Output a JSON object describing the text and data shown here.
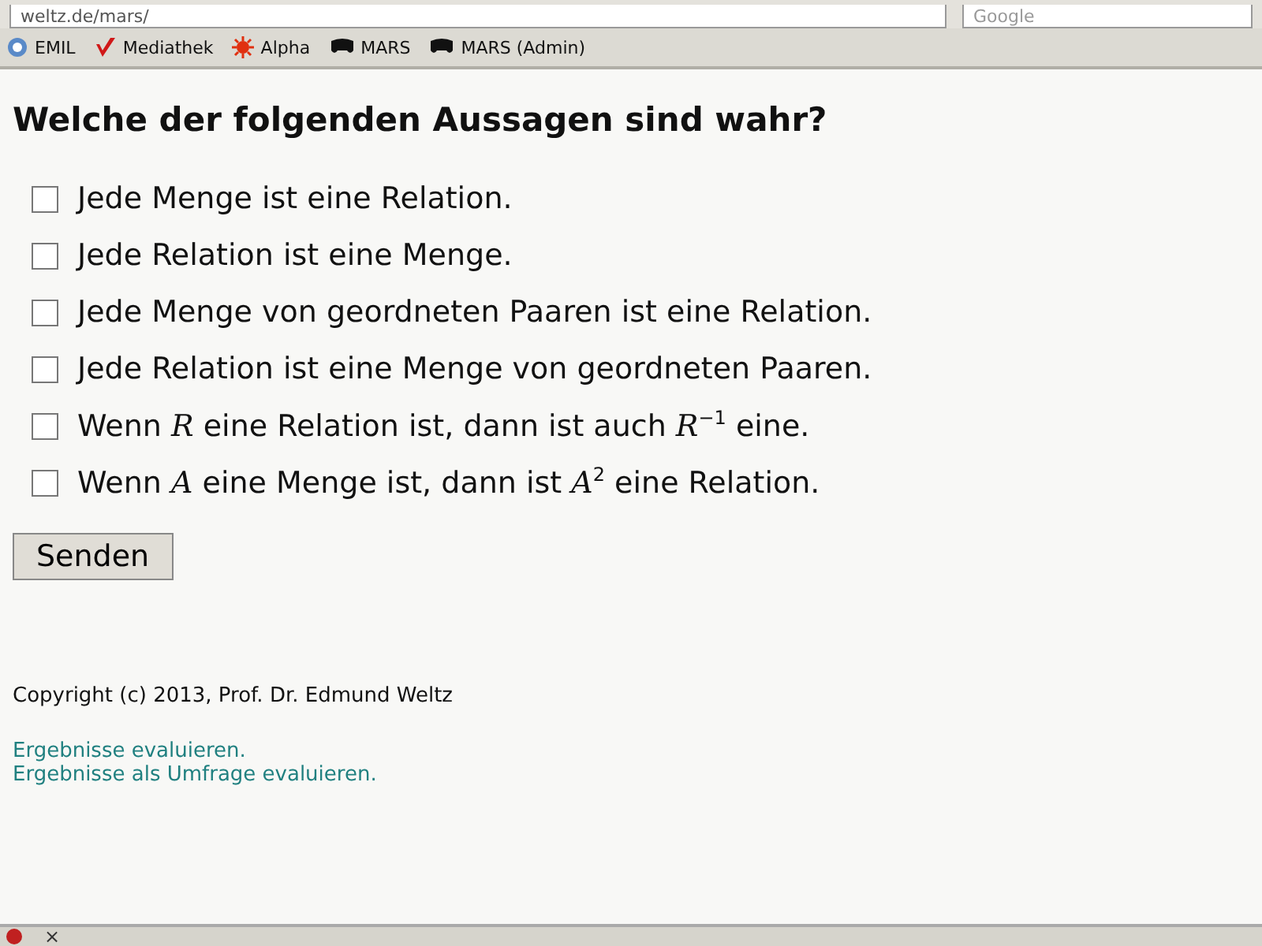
{
  "browser": {
    "address": "weltz.de/mars/",
    "search_placeholder": "Google"
  },
  "bookmarks": [
    {
      "label": "EMIL"
    },
    {
      "label": "Mediathek"
    },
    {
      "label": "Alpha"
    },
    {
      "label": "MARS"
    },
    {
      "label": "MARS (Admin)"
    }
  ],
  "question": "Welche der folgenden Aussagen sind wahr?",
  "options": [
    {
      "text": "Jede Menge ist eine Relation.",
      "checked": false
    },
    {
      "text": "Jede Relation ist eine Menge.",
      "checked": false
    },
    {
      "text": "Jede Menge von geordneten Paaren ist eine Relation.",
      "checked": false
    },
    {
      "text": "Jede Relation ist eine Menge von geordneten Paaren.",
      "checked": false
    },
    {
      "text": "Wenn *R* eine Relation ist, dann ist auch *R*$^{−1}$ eine.",
      "checked": false
    },
    {
      "text": "Wenn *A* eine Menge ist, dann ist *A*$^{2}$ eine Relation.",
      "checked": false
    }
  ],
  "submit": "Senden",
  "copyright": "Copyright (c) 2013, Prof. Dr. Edmund Weltz",
  "links": [
    "Ergebnisse evaluieren.",
    "Ergebnisse als Umfrage evaluieren."
  ],
  "addon_bar": {
    "close": "×"
  }
}
